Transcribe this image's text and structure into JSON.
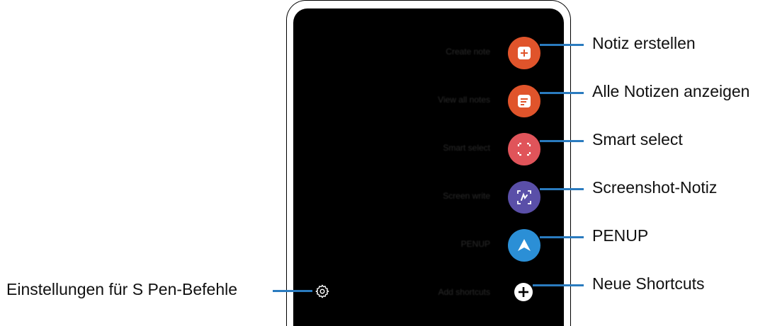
{
  "menu": {
    "items": [
      {
        "label": "Create note",
        "callout": "Notiz erstellen",
        "color": "#e0542b",
        "icon": "create-note-icon"
      },
      {
        "label": "View all notes",
        "callout": "Alle Notizen anzeigen",
        "color": "#e0542b",
        "icon": "view-notes-icon"
      },
      {
        "label": "Smart select",
        "callout": "Smart select",
        "color": "#e0545a",
        "icon": "smart-select-icon"
      },
      {
        "label": "Screen write",
        "callout": "Screenshot-Notiz",
        "color": "#5a4fa8",
        "icon": "screen-write-icon"
      },
      {
        "label": "PENUP",
        "callout": "PENUP",
        "color": "#2b8fd6",
        "icon": "penup-icon"
      },
      {
        "label": "Add shortcuts",
        "callout": "Neue Shortcuts",
        "color": "#ffffff",
        "icon": "plus-icon"
      }
    ]
  },
  "settings": {
    "callout": "Einstellungen für S Pen-Befehle",
    "icon": "gear-icon"
  },
  "colors": {
    "callout_line": "#2a7bbf"
  }
}
